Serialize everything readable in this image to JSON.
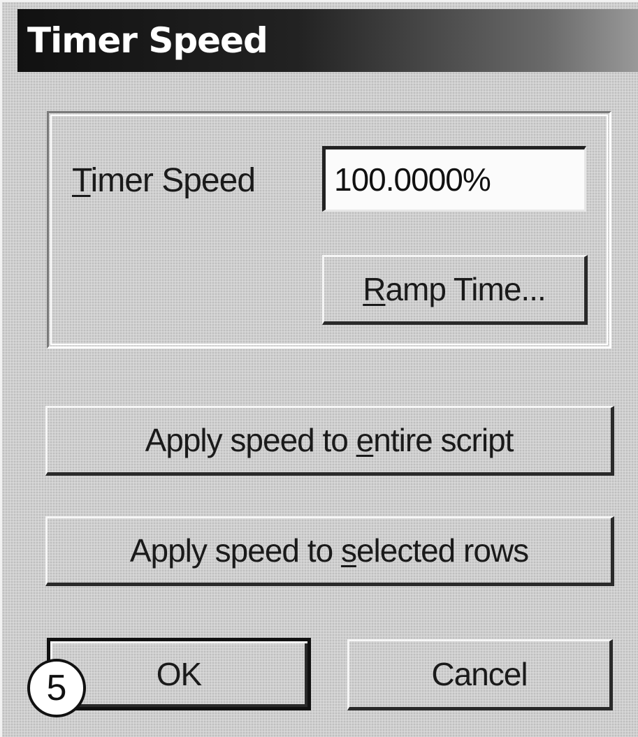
{
  "window": {
    "title": "Timer Speed"
  },
  "timer_speed": {
    "label_mnemonic": "T",
    "label_rest": "imer Speed",
    "value": "100.0000%"
  },
  "buttons": {
    "ramp_mnemonic": "R",
    "ramp_rest": "amp Time...",
    "entire_pre": "Apply speed to ",
    "entire_mnemonic": "e",
    "entire_post": "ntire script",
    "selected_pre": "Apply speed to ",
    "selected_mnemonic": "s",
    "selected_post": "elected rows",
    "ok": "OK",
    "cancel": "Cancel"
  },
  "callout": {
    "number": "5"
  }
}
